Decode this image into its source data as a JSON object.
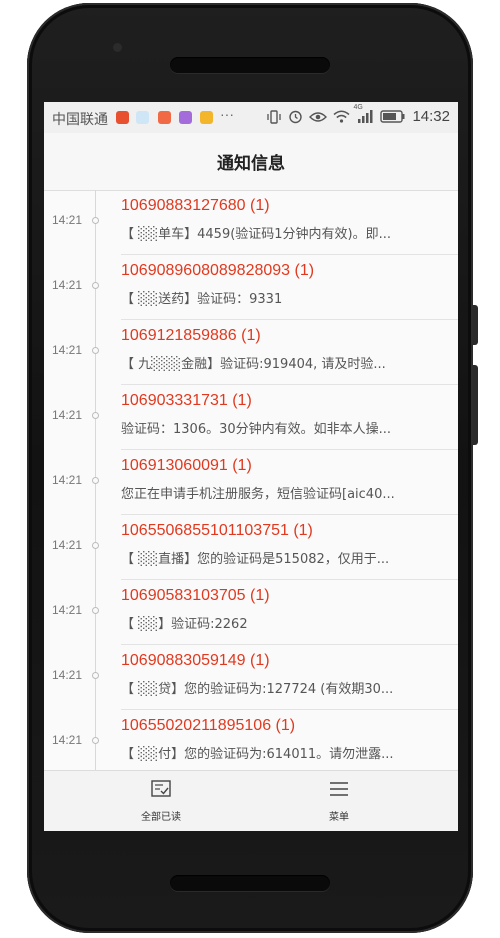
{
  "status_bar": {
    "carrier": "中国联通",
    "network": "4G",
    "time": "14:32"
  },
  "app_bar": {
    "title": "通知信息"
  },
  "messages": [
    {
      "time": "14:21",
      "title": "10690883127680 (1)",
      "body": "【 ░░单车】4459(验证码1分钟内有效)。即..."
    },
    {
      "time": "14:21",
      "title": "1069089608089828093 (1)",
      "body": "【 ░░送药】验证码：9331"
    },
    {
      "time": "14:21",
      "title": "1069121859886 (1)",
      "body": "【 九░░░金融】验证码:919404, 请及时验..."
    },
    {
      "time": "14:21",
      "title": "106903331731 (1)",
      "body": "验证码：1306。30分钟内有效。如非本人操..."
    },
    {
      "time": "14:21",
      "title": "106913060091 (1)",
      "body": "您正在申请手机注册服务，短信验证码[aic40..."
    },
    {
      "time": "14:21",
      "title": "1065506855101103751 (1)",
      "body": "【 ░░直播】您的验证码是515082，仅用于..."
    },
    {
      "time": "14:21",
      "title": "10690583103705 (1)",
      "body": "【 ░░】验证码:2262"
    },
    {
      "time": "14:21",
      "title": "10690883059149 (1)",
      "body": "【 ░░贷】您的验证码为:127724 (有效期30..."
    },
    {
      "time": "14:21",
      "title": "10655020211895106 (1)",
      "body": "【 ░░付】您的验证码为:614011。请勿泄露..."
    }
  ],
  "bottom_bar": {
    "mark_all_read": "全部已读",
    "menu": "菜单"
  },
  "colors": {
    "accent_red": "#e0391f",
    "body_text": "#555555",
    "background": "#fafafa"
  }
}
